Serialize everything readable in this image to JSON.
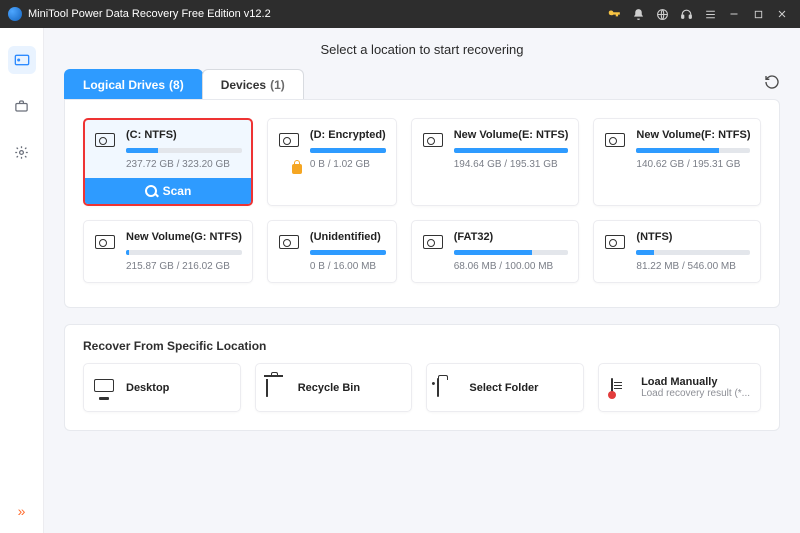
{
  "titlebar": {
    "app_title": "MiniTool Power Data Recovery Free Edition v12.2"
  },
  "page": {
    "heading": "Select a location to start recovering"
  },
  "tabs": {
    "logical": {
      "label": "Logical Drives",
      "count": "(8)"
    },
    "devices": {
      "label": "Devices",
      "count": "(1)"
    }
  },
  "scan_label": "Scan",
  "drives": [
    {
      "name": "(C: NTFS)",
      "size": "237.72 GB / 323.20 GB",
      "pct": 28,
      "locked": false,
      "selected": true
    },
    {
      "name": "(D: Encrypted)",
      "size": "0 B / 1.02 GB",
      "pct": 100,
      "locked": true,
      "selected": false
    },
    {
      "name": "New Volume(E: NTFS)",
      "size": "194.64 GB / 195.31 GB",
      "pct": 100,
      "locked": false,
      "selected": false
    },
    {
      "name": "New Volume(F: NTFS)",
      "size": "140.62 GB / 195.31 GB",
      "pct": 72,
      "locked": false,
      "selected": false
    },
    {
      "name": "New Volume(G: NTFS)",
      "size": "215.87 GB / 216.02 GB",
      "pct": 3,
      "locked": false,
      "selected": false
    },
    {
      "name": "(Unidentified)",
      "size": "0 B / 16.00 MB",
      "pct": 100,
      "locked": false,
      "selected": false
    },
    {
      "name": "(FAT32)",
      "size": "68.06 MB / 100.00 MB",
      "pct": 68,
      "locked": false,
      "selected": false
    },
    {
      "name": "(NTFS)",
      "size": "81.22 MB / 546.00 MB",
      "pct": 15,
      "locked": false,
      "selected": false
    }
  ],
  "recover_section": {
    "title": "Recover From Specific Location",
    "items": [
      {
        "label": "Desktop",
        "icon": "monitor",
        "sub": ""
      },
      {
        "label": "Recycle Bin",
        "icon": "trash",
        "sub": ""
      },
      {
        "label": "Select Folder",
        "icon": "folder",
        "sub": ""
      },
      {
        "label": "Load Manually",
        "icon": "doc",
        "sub": "Load recovery result (*..."
      }
    ]
  }
}
